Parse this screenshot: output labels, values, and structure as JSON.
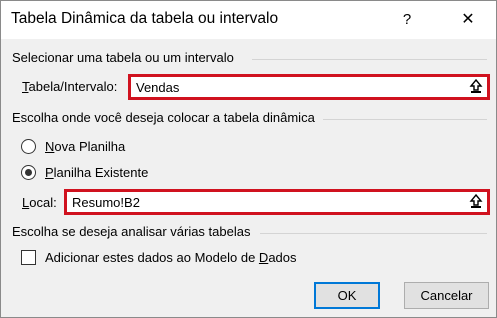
{
  "dialog": {
    "title": "Tabela Dinâmica da tabela ou intervalo",
    "help_glyph": "?",
    "close_glyph": "✕"
  },
  "select_section": {
    "heading": "Selecionar uma tabela ou um intervalo",
    "label_underlined": "T",
    "label_rest": "abela/Intervalo:",
    "value": "Vendas",
    "collapse_icon": "collapse-dialog-icon"
  },
  "location_section": {
    "heading": "Escolha onde você deseja colocar a tabela dinâmica",
    "options": [
      {
        "underlined": "N",
        "rest": "ova Planilha",
        "checked": false
      },
      {
        "underlined": "P",
        "rest": "lanilha Existente",
        "checked": true
      }
    ],
    "local_label_underlined": "L",
    "local_label_rest": "ocal:",
    "local_value": "Resumo!B2"
  },
  "multi_section": {
    "heading": "Escolha se deseja analisar várias tabelas",
    "checkbox_label_before": "Adicionar estes dados ao Modelo de ",
    "checkbox_label_underlined": "D",
    "checkbox_label_after": "ados",
    "checked": false
  },
  "buttons": {
    "ok": "OK",
    "cancel": "Cancelar"
  },
  "colors": {
    "highlight": "#d0121f",
    "focus": "#0078d7"
  }
}
